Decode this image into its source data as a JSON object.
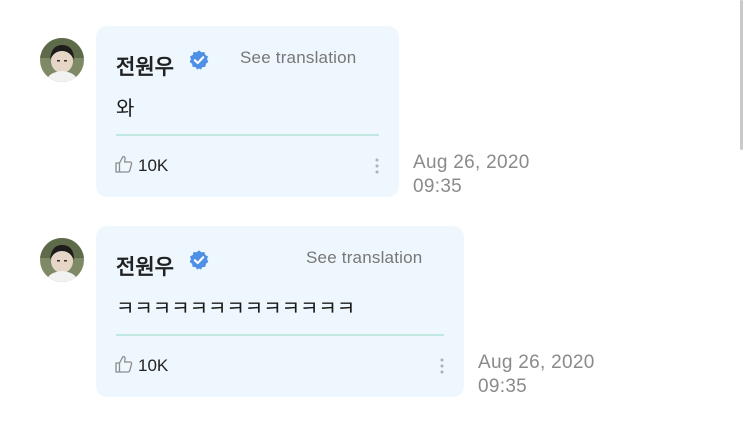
{
  "comments": [
    {
      "author": "전원우",
      "translate_label": "See translation",
      "text": "와",
      "likes": "10K",
      "date": "Aug 26, 2020",
      "time": "09:35"
    },
    {
      "author": "전원우",
      "translate_label": "See translation",
      "text": "ㅋㅋㅋㅋㅋㅋㅋㅋㅋㅋㅋㅋㅋ",
      "likes": "10K",
      "date": "Aug 26, 2020",
      "time": "09:35"
    }
  ],
  "colors": {
    "bubble_background": "#eef7fd",
    "verified_badge": "#4f8fe6",
    "divider": "#c2e7e1"
  },
  "icons": [
    "avatar",
    "verified-badge-icon",
    "thumbs-up-icon",
    "more-options-icon"
  ]
}
